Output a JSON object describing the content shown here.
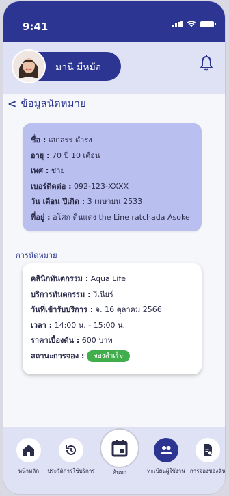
{
  "status": {
    "time": "9:41"
  },
  "profile": {
    "name": "มานี มีหม้อ"
  },
  "page": {
    "title": "ข้อมูลนัดหมาย"
  },
  "patient": {
    "name_label": "ชื่อ :",
    "name_value": "เสกสรร ดำรง",
    "age_label": "อายุ :",
    "age_value": "70 ปี 10 เดือน",
    "sex_label": "เพศ :",
    "sex_value": "ชาย",
    "phone_label": "เบอร์ติดต่อ :",
    "phone_value": "092-123-XXXX",
    "dob_label": "วัน เดือน ปีเกิด :",
    "dob_value": "3 เมษายน 2533",
    "address_label": "ที่อยู่ :",
    "address_value": "อโศก ดินแดง the Line ratchada Asoke"
  },
  "appointment": {
    "section_title": "การนัดหมาย",
    "clinic_label": "คลินิกทันตกรรม :",
    "clinic_value": "Aqua Life",
    "service_label": "บริการทันตกรรม :",
    "service_value": "วีเนียร์",
    "date_label": "วันที่เข้ารับบริการ :",
    "date_value": "จ. 16 ตุลาคม 2566",
    "time_label": "เวลา :",
    "time_value": "14:00 น. - 15:00 น.",
    "price_label": "ราคาเบื้องต้น :",
    "price_value": "600 บาท",
    "status_label": "สถานะการจอง :",
    "status_value": "จองสำเร็จ"
  },
  "nav": {
    "home": "หน้าหลัก",
    "history": "ประวัติการใช้บริการ",
    "search": "ค้นหา",
    "register": "ทะเบียนผู้ใช้งาน",
    "bookings": "การจองของฉัน"
  },
  "colors": {
    "primary": "#2c3592",
    "card_bg": "#b9bfee",
    "success": "#3fae4b"
  }
}
